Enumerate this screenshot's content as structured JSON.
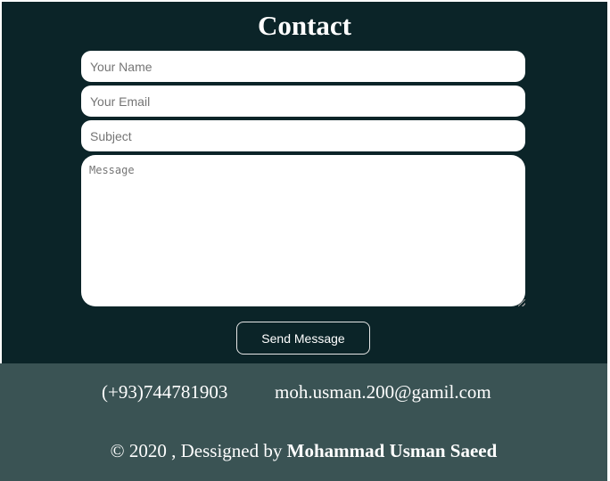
{
  "contact": {
    "title": "Contact",
    "name_placeholder": "Your Name",
    "email_placeholder": "Your Email",
    "subject_placeholder": "Subject",
    "message_placeholder": "Message",
    "send_label": "Send Message"
  },
  "footer": {
    "phone": "(+93)744781903",
    "email": "moh.usman.200@gamil.com",
    "copyright_prefix": "© 2020 , Dessigned by ",
    "author": "Mohammad Usman Saeed"
  },
  "colors": {
    "contact_background": "#0b2428",
    "footer_background": "#3a5354",
    "text": "#ffffff"
  }
}
